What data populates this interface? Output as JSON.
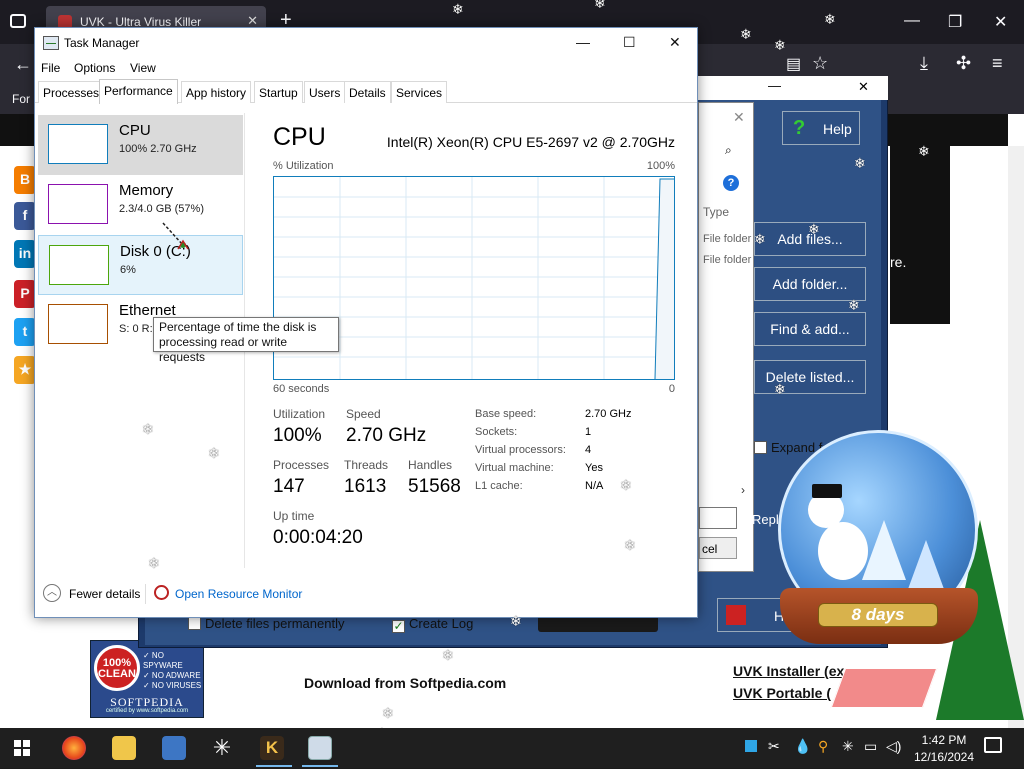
{
  "browser": {
    "tab_title": "UVK - Ultra Virus Killer",
    "tab_close": "✕",
    "new_tab": "+",
    "window_controls": {
      "minimize": "—",
      "maximize": "❐",
      "close": "✕"
    },
    "nav_left_label": "For"
  },
  "webpage": {
    "download_title": "Download from Softpedia.com",
    "link_installer": "UVK Installer (ex",
    "link_portable": "UVK Portable (",
    "badge": {
      "seal_text": "100% CLEAN",
      "checks": [
        "✓ NO SPYWARE",
        "✓ NO ADWARE",
        "✓ NO VIRUSES"
      ],
      "brand": "SOFTPEDIA",
      "certified": "certified by www.softpedia.com"
    },
    "side_text": "re."
  },
  "uvk": {
    "help_label": "Help",
    "type_header": "Type",
    "file_folder_1": "File folder",
    "file_folder_2": "File folder",
    "add_files": "Add files...",
    "add_folder": "Add folder...",
    "find_add": "Find & add...",
    "delete_listed": "Delete listed...",
    "expand_label": "Expand f",
    "replace_label": "Repl",
    "cancel_label": "cel",
    "delete_permanently": "Delete files permanently",
    "create_log": "Create Log",
    "home_label": "H"
  },
  "globe": {
    "banner": "8 days"
  },
  "task_manager": {
    "title": "Task Manager",
    "window_controls": {
      "minimize": "—",
      "maximize": "☐",
      "close": "✕"
    },
    "menu": [
      "File",
      "Options",
      "View"
    ],
    "tabs": [
      "Processes",
      "Performance",
      "App history",
      "Startup",
      "Users",
      "Details",
      "Services"
    ],
    "active_tab": "Performance",
    "sidebar": [
      {
        "name": "CPU",
        "sub": "100%  2.70 GHz",
        "color": "#117dbb"
      },
      {
        "name": "Memory",
        "sub": "2.3/4.0 GB (57%)",
        "color": "#8b12ae"
      },
      {
        "name": "Disk 0 (C:)",
        "sub": "6%",
        "color": "#4da60c"
      },
      {
        "name": "Ethernet",
        "sub": "S: 0  R:",
        "color": "#a74f01"
      }
    ],
    "main": {
      "heading": "CPU",
      "model": "Intel(R) Xeon(R) CPU E5-2697 v2 @ 2.70GHz",
      "util_label": "% Utilization",
      "util_max": "100%",
      "time_window": "60 seconds",
      "time_zero": "0",
      "stats": {
        "utilization_label": "Utilization",
        "utilization": "100%",
        "speed_label": "Speed",
        "speed": "2.70 GHz",
        "processes_label": "Processes",
        "processes": "147",
        "threads_label": "Threads",
        "threads": "1613",
        "handles_label": "Handles",
        "handles": "51568",
        "uptime_label": "Up time",
        "uptime": "0:00:04:20"
      },
      "details": [
        {
          "label": "Base speed:",
          "value": "2.70 GHz"
        },
        {
          "label": "Sockets:",
          "value": "1"
        },
        {
          "label": "Virtual processors:",
          "value": "4"
        },
        {
          "label": "Virtual machine:",
          "value": "Yes"
        },
        {
          "label": "L1 cache:",
          "value": "N/A"
        }
      ]
    },
    "footer": {
      "fewer_details": "Fewer details",
      "resource_monitor": "Open Resource Monitor"
    },
    "tooltip": "Percentage of time the disk is processing read or write requests"
  },
  "taskbar": {
    "time": "1:42 PM",
    "date": "12/16/2024"
  },
  "colors": {
    "cpu_accent": "#117dbb",
    "memory_accent": "#8b12ae",
    "disk_accent": "#4da60c",
    "ethernet_accent": "#a74f01",
    "link": "#0066cc"
  }
}
